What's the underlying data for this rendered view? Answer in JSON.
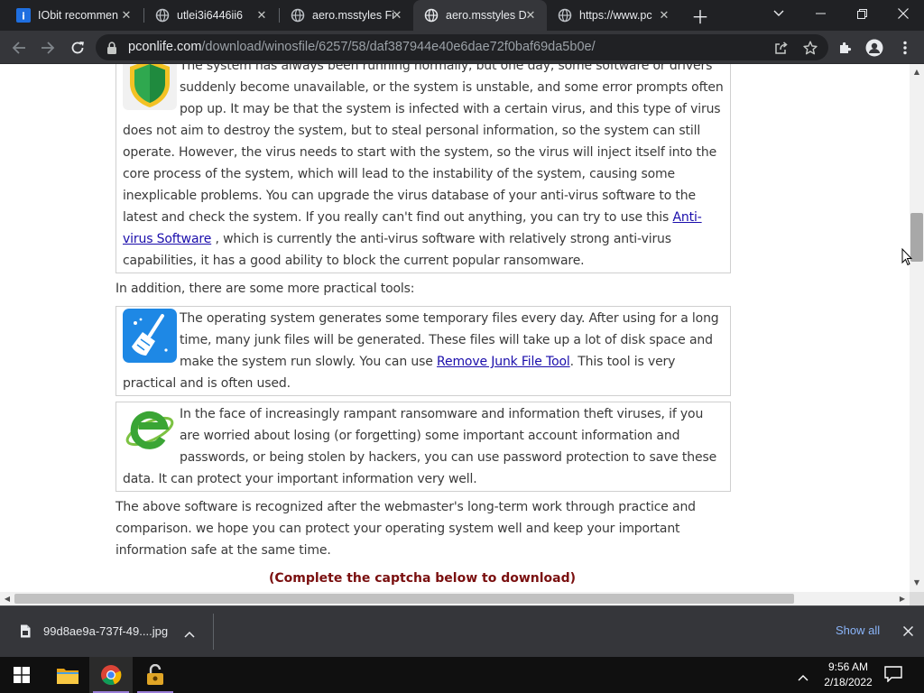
{
  "browser": {
    "tabs": [
      {
        "title": "IObit recommen",
        "favicon": "iobit-icon",
        "active": false
      },
      {
        "title": "utlei3i6446ii6",
        "favicon": "globe-icon",
        "active": false
      },
      {
        "title": "aero.msstyles Fi",
        "favicon": "globe-icon",
        "active": false
      },
      {
        "title": "aero.msstyles D",
        "favicon": "globe-icon",
        "active": true
      },
      {
        "title": "https://www.pc",
        "favicon": "globe-icon",
        "active": false
      }
    ],
    "url_host": "pconlife.com",
    "url_path": "/download/winosfile/6257/58/daf387944e40e6dae72f0baf69da5b0e/"
  },
  "page": {
    "virus_box": {
      "text_a": "The system has always been running normally, but one day, some software or drivers suddenly become unavailable, or the system is unstable, and some error prompts often pop up. It may be that the system is infected with a certain virus, and this type of virus does not aim to destroy the system, but to steal personal information, so the system can still operate. However, the virus needs to start with the system, so the virus will inject itself into the core process of the system, which will lead to the instability of the system, causing some inexplicable problems. You can upgrade the virus database of your anti-virus software to the latest and check the system. If you really can't find out anything, you can try to use this ",
      "link": "Anti-virus Software",
      "text_b": " , which is currently the anti-virus software with relatively strong anti-virus capabilities, it has a good ability to block the current popular ransomware."
    },
    "tools_intro": "In addition, there are some more practical tools:",
    "junk_box": {
      "text_a": "The operating system generates some temporary files every day. After using for a long time, many junk files will be generated. These files will take up a lot of disk space and make the system run slowly. You can use ",
      "link": "Remove Junk File Tool",
      "text_b": ". This tool is very practical and is often used."
    },
    "password_box": {
      "text": "In the face of increasingly rampant ransomware and information theft viruses, if you are worried about losing (or forgetting) some important account information and passwords, or being stolen by hackers, you can use password protection to save these data. It can protect your important information very well."
    },
    "closing": "The above software is recognized after the webmaster's long-term work through practice and comparison. we hope you can protect your operating system well and keep your important information safe at the same time.",
    "captcha_notice": "(Complete the captcha below to download)"
  },
  "downloads": {
    "file_name": "99d8ae9a-737f-49....jpg",
    "show_all": "Show all"
  },
  "taskbar": {
    "time": "9:56 AM",
    "date": "2/18/2022"
  },
  "colors": {
    "link": "#1a0dab",
    "captcha": "#7a0f0f",
    "show_all": "#8ab4f8",
    "running_indicator": "#9a7ed8"
  }
}
